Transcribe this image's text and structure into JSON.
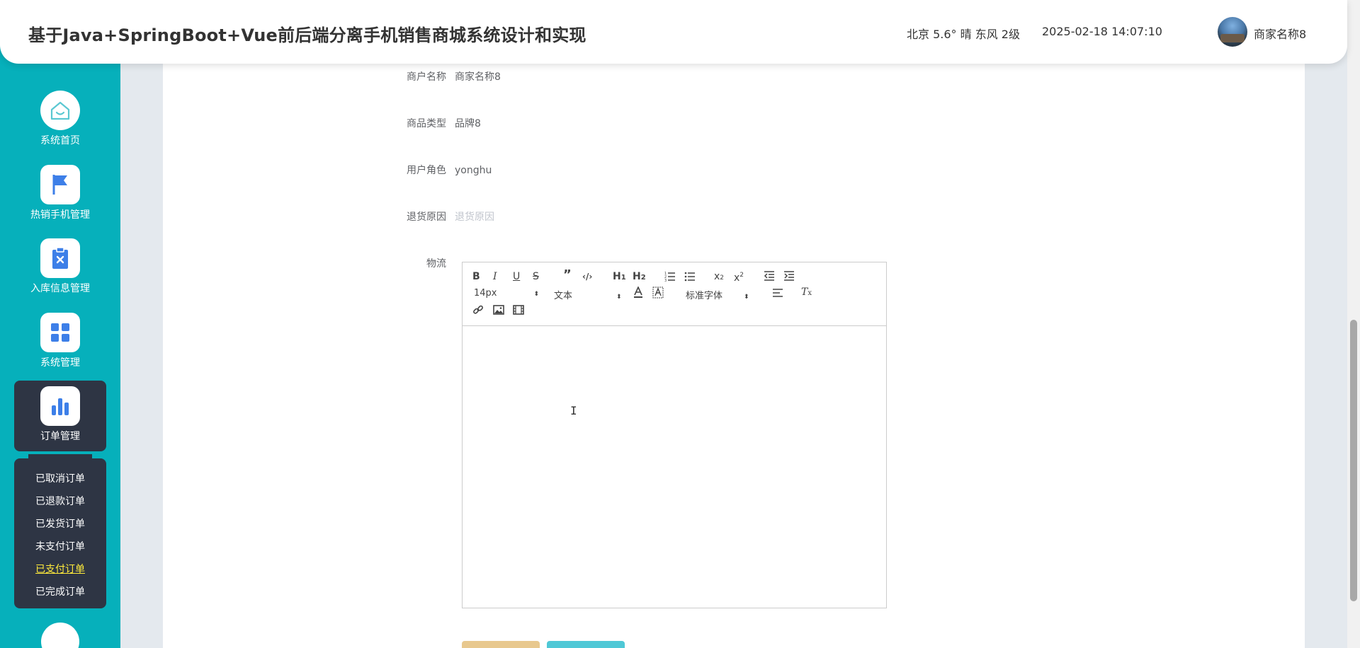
{
  "header": {
    "title": "基于Java+SpringBoot+Vue前后端分离手机销售商城系统设计和实现",
    "weather": "北京  5.6°  晴  东风  2级",
    "datetime": "2025-02-18 14:07:10",
    "username": "商家名称8"
  },
  "sidebar": {
    "items": [
      {
        "label": "系统首页",
        "icon": "home-icon"
      },
      {
        "label": "热销手机管理",
        "icon": "flag-icon"
      },
      {
        "label": "入库信息管理",
        "icon": "clipboard-x-icon"
      },
      {
        "label": "系统管理",
        "icon": "grid-icon"
      },
      {
        "label": "订单管理",
        "icon": "bar-chart-icon"
      }
    ],
    "submenu": [
      {
        "label": "已取消订单"
      },
      {
        "label": "已退款订单"
      },
      {
        "label": "已发货订单"
      },
      {
        "label": "未支付订单"
      },
      {
        "label": "已支付订单"
      },
      {
        "label": "已完成订单"
      }
    ]
  },
  "form": {
    "merchant_name_label": "商户名称",
    "merchant_name_value": "商家名称8",
    "goods_type_label": "商品类型",
    "goods_type_value": "品牌8",
    "user_role_label": "用户角色",
    "user_role_value": "yonghu",
    "return_reason_label": "退货原因",
    "return_reason_placeholder": "退货原因",
    "logistics_label": "物流"
  },
  "editor": {
    "font_size": "14px",
    "header_select": "文本",
    "font_family": "标准字体"
  }
}
